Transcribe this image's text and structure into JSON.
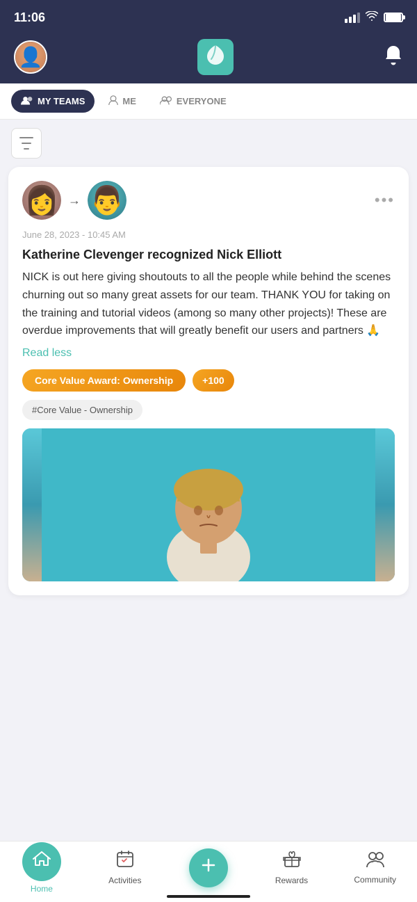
{
  "status": {
    "time": "11:06"
  },
  "topnav": {
    "logo_alt": "Leaf logo"
  },
  "tabs": {
    "items": [
      {
        "id": "my-teams",
        "label": "MY TEAMS",
        "icon": "👥",
        "active": true
      },
      {
        "id": "me",
        "label": "ME",
        "icon": "👤",
        "active": false
      },
      {
        "id": "everyone",
        "label": "EVERYONE",
        "icon": "👥",
        "active": false
      }
    ]
  },
  "filter": {
    "icon_label": "filter"
  },
  "post": {
    "date": "June 28, 2023 - 10:45 AM",
    "title": "Katherine Clevenger recognized Nick Elliott",
    "body": "NICK is out here giving shoutouts to all the people while behind the scenes churning out so many great assets for our team. THANK YOU for taking on the training and tutorial videos (among so many other projects)! These are overdue improvements that will greatly benefit our users and partners 🙏",
    "read_less_label": "Read less",
    "badge_label": "Core Value Award: Ownership",
    "points_label": "+100",
    "hashtag_label": "#Core Value - Ownership",
    "more_button_label": "•••",
    "arrow_label": "→"
  },
  "bottom_nav": {
    "items": [
      {
        "id": "home",
        "label": "Home",
        "icon": "🏠",
        "active": true
      },
      {
        "id": "activities",
        "label": "Activities",
        "icon": "📅",
        "active": false
      },
      {
        "id": "add",
        "label": "",
        "icon": "+",
        "active": false
      },
      {
        "id": "rewards",
        "label": "Rewards",
        "icon": "🎁",
        "active": false
      },
      {
        "id": "community",
        "label": "Community",
        "icon": "👥",
        "active": false
      }
    ]
  }
}
